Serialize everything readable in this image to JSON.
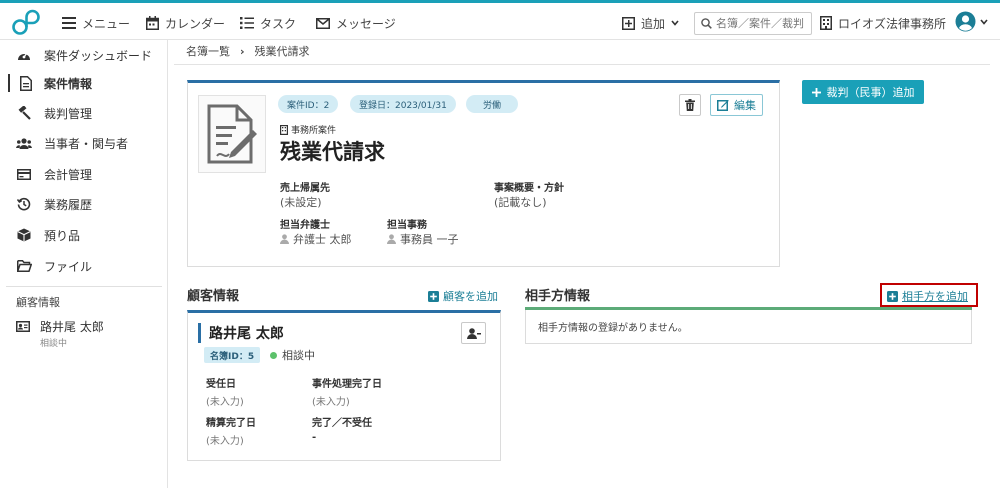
{
  "topbar": {
    "menu_label": "メニュー",
    "calendar_label": "カレンダー",
    "task_label": "タスク",
    "message_label": "メッセージ",
    "add_label": "追加",
    "search_placeholder": "名簿／案件／裁判",
    "firm_name": "ロイオズ法律事務所",
    "accent_color": "#1aa0b8"
  },
  "sidebar": {
    "items": [
      {
        "label": "案件ダッシュボード",
        "icon": "dashboard-icon"
      },
      {
        "label": "案件情報",
        "icon": "document-icon",
        "active": true
      },
      {
        "label": "裁判管理",
        "icon": "gavel-icon"
      },
      {
        "label": "当事者・関与者",
        "icon": "people-icon"
      },
      {
        "label": "会計管理",
        "icon": "credit-card-icon"
      },
      {
        "label": "業務履歴",
        "icon": "history-icon"
      },
      {
        "label": "預り品",
        "icon": "box-icon"
      },
      {
        "label": "ファイル",
        "icon": "folder-icon"
      }
    ],
    "section_label": "顧客情報",
    "client": {
      "name": "路井尾 太郎",
      "status": "相談中"
    }
  },
  "breadcrumb": {
    "parent": "名簿一覧",
    "separator": "›",
    "current": "残業代請求"
  },
  "matter": {
    "case_id_tag": "案件ID：2",
    "registered_tag": "登録日：2023/01/31",
    "category_tag": "労働",
    "edit_label": "編集",
    "office_label": "事務所案件",
    "title": "残業代請求",
    "sales_label": "売上帰属先",
    "sales_value": "(未設定)",
    "summary_label": "事案概要・方針",
    "summary_value": "(記載なし)",
    "lawyer_label": "担当弁護士",
    "lawyer_value": "弁護士 太郎",
    "clerk_label": "担当事務",
    "clerk_value": "事務員 一子"
  },
  "court_button_label": "裁判（民事）追加",
  "client_section": {
    "heading": "顧客情報",
    "add_label": "顧客を追加",
    "client_name": "路井尾 太郎",
    "id_badge": "名簿ID：5",
    "status": "相談中",
    "received_label": "受任日",
    "received_value": "(未入力)",
    "completed_label": "事件処理完了日",
    "completed_value": "(未入力)",
    "settled_label": "精算完了日",
    "settled_value": "(未入力)",
    "done_label": "完了／不受任",
    "done_value": "-"
  },
  "opponent_section": {
    "heading": "相手方情報",
    "add_label": "相手方を追加",
    "empty_message": "相手方情報の登録がありません。"
  }
}
